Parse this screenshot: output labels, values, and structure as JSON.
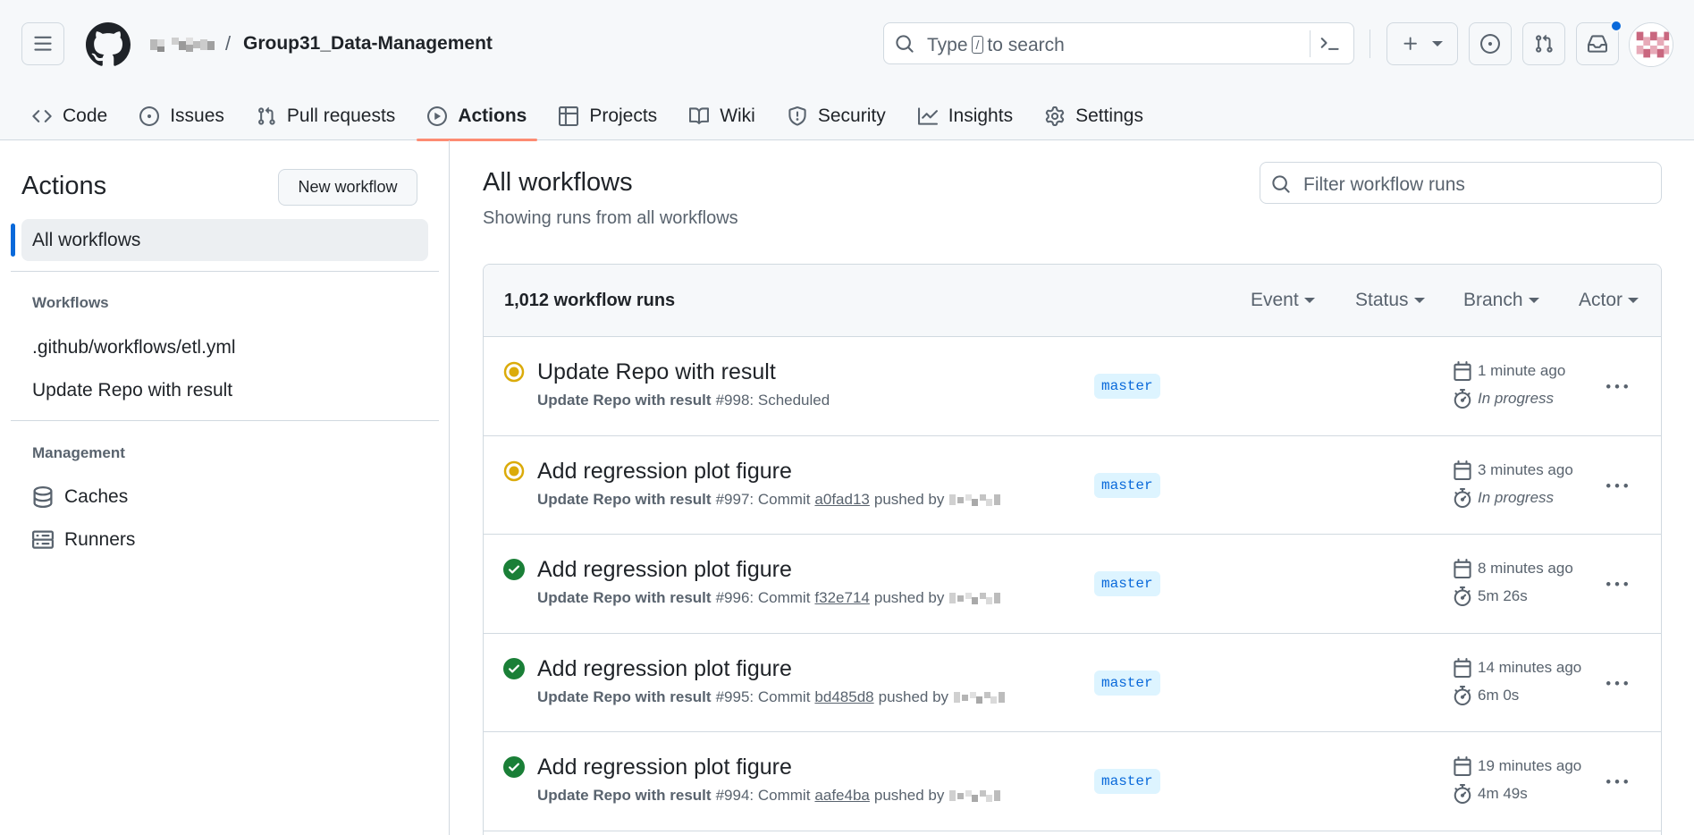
{
  "repo": {
    "owner_hidden": true,
    "separator": "/",
    "name": "Group31_Data-Management"
  },
  "search": {
    "prefix": "Type",
    "key": "/",
    "suffix": "to search"
  },
  "tabs": [
    {
      "label": "Code",
      "icon": "code-icon"
    },
    {
      "label": "Issues",
      "icon": "issue-opened-icon"
    },
    {
      "label": "Pull requests",
      "icon": "git-pull-request-icon"
    },
    {
      "label": "Actions",
      "icon": "play-icon",
      "active": true
    },
    {
      "label": "Projects",
      "icon": "table-icon"
    },
    {
      "label": "Wiki",
      "icon": "book-icon"
    },
    {
      "label": "Security",
      "icon": "shield-icon"
    },
    {
      "label": "Insights",
      "icon": "graph-icon"
    },
    {
      "label": "Settings",
      "icon": "gear-icon"
    }
  ],
  "sidebar": {
    "title": "Actions",
    "new_workflow": "New workflow",
    "all_workflows": "All workflows",
    "workflows_heading": "Workflows",
    "workflows": [
      ".github/workflows/etl.yml",
      "Update Repo with result"
    ],
    "management_heading": "Management",
    "management": [
      {
        "label": "Caches",
        "icon": "database-icon"
      },
      {
        "label": "Runners",
        "icon": "server-icon"
      }
    ]
  },
  "main": {
    "title": "All workflows",
    "subtitle": "Showing runs from all workflows",
    "filter_placeholder": "Filter workflow runs",
    "runs_count": "1,012 workflow runs",
    "filters": [
      "Event",
      "Status",
      "Branch",
      "Actor"
    ]
  },
  "runs": [
    {
      "status": "in_progress",
      "title": "Update Repo with result",
      "workflow": "Update Repo with result",
      "number": "#998:",
      "detail": "Scheduled",
      "sha": "",
      "pushed_by": "",
      "branch": "master",
      "when": "1 minute ago",
      "duration": "In progress"
    },
    {
      "status": "in_progress",
      "title": "Add regression plot figure",
      "workflow": "Update Repo with result",
      "number": "#997:",
      "detail": "Commit",
      "sha": "a0fad13",
      "pushed_by": "pushed by",
      "branch": "master",
      "when": "3 minutes ago",
      "duration": "In progress"
    },
    {
      "status": "success",
      "title": "Add regression plot figure",
      "workflow": "Update Repo with result",
      "number": "#996:",
      "detail": "Commit",
      "sha": "f32e714",
      "pushed_by": "pushed by",
      "branch": "master",
      "when": "8 minutes ago",
      "duration": "5m 26s"
    },
    {
      "status": "success",
      "title": "Add regression plot figure",
      "workflow": "Update Repo with result",
      "number": "#995:",
      "detail": "Commit",
      "sha": "bd485d8",
      "pushed_by": "pushed by",
      "branch": "master",
      "when": "14 minutes ago",
      "duration": "6m 0s"
    },
    {
      "status": "success",
      "title": "Add regression plot figure",
      "workflow": "Update Repo with result",
      "number": "#994:",
      "detail": "Commit",
      "sha": "aafe4ba",
      "pushed_by": "pushed by",
      "branch": "master",
      "when": "19 minutes ago",
      "duration": "4m 49s"
    }
  ],
  "colors": {
    "accent": "#0969da",
    "success": "#1a7f37",
    "in_progress": "#dbab0a",
    "tab_underline": "#fd8c73"
  }
}
